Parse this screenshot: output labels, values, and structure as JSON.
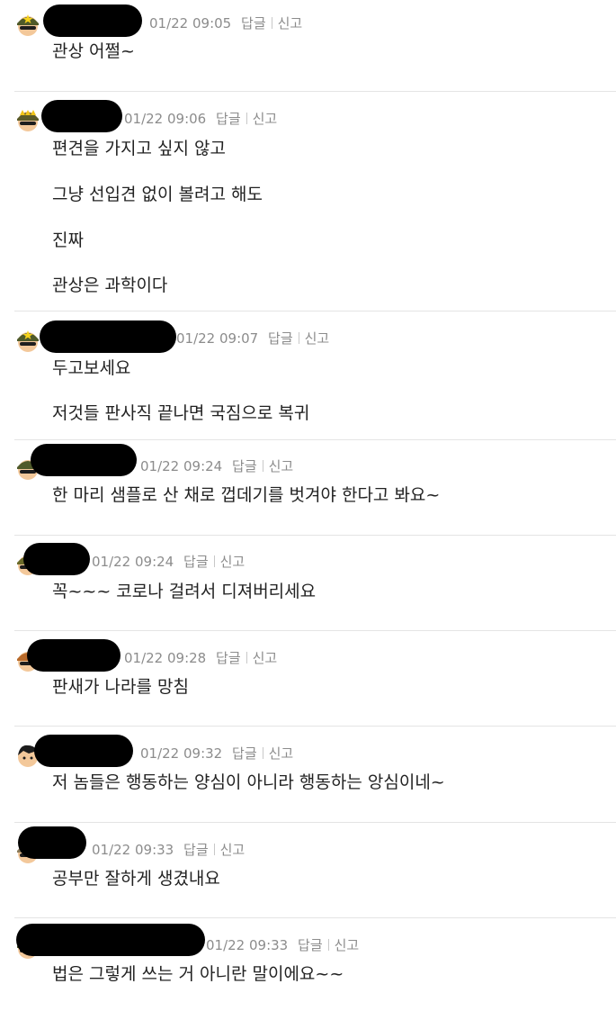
{
  "labels": {
    "reply": "답글",
    "report": "신고"
  },
  "comments": [
    {
      "time": "01/22 09:05",
      "lines": [
        "관상 어쩔~"
      ]
    },
    {
      "time": "01/22 09:06",
      "lines": [
        "편견을 가지고 싶지 않고",
        "그냥 선입견 없이 볼려고 해도",
        "진짜",
        "관상은 과학이다"
      ]
    },
    {
      "time": "01/22 09:07",
      "lines": [
        "두고보세요",
        "저것들 판사직 끝나면 국짐으로 복귀"
      ]
    },
    {
      "time": "01/22 09:24",
      "lines": [
        "한 마리 샘플로 산 채로 껍데기를 벗겨야 한다고 봐요~"
      ]
    },
    {
      "time": "01/22 09:24",
      "lines": [
        "꼭~~~ 코로나 걸려서 디져버리세요"
      ]
    },
    {
      "time": "01/22 09:28",
      "lines": [
        "판새가 나라를 망침"
      ]
    },
    {
      "time": "01/22 09:32",
      "lines": [
        "저 놈들은 행동하는 양심이 아니라 행동하는 앙심이네~"
      ]
    },
    {
      "time": "01/22 09:33",
      "lines": [
        "공부만 잘하게 생겼내요"
      ]
    },
    {
      "time": "01/22 09:33",
      "lines": [
        "법은 그렇게 쓰는 거 아니란 말이에요~~"
      ]
    }
  ]
}
